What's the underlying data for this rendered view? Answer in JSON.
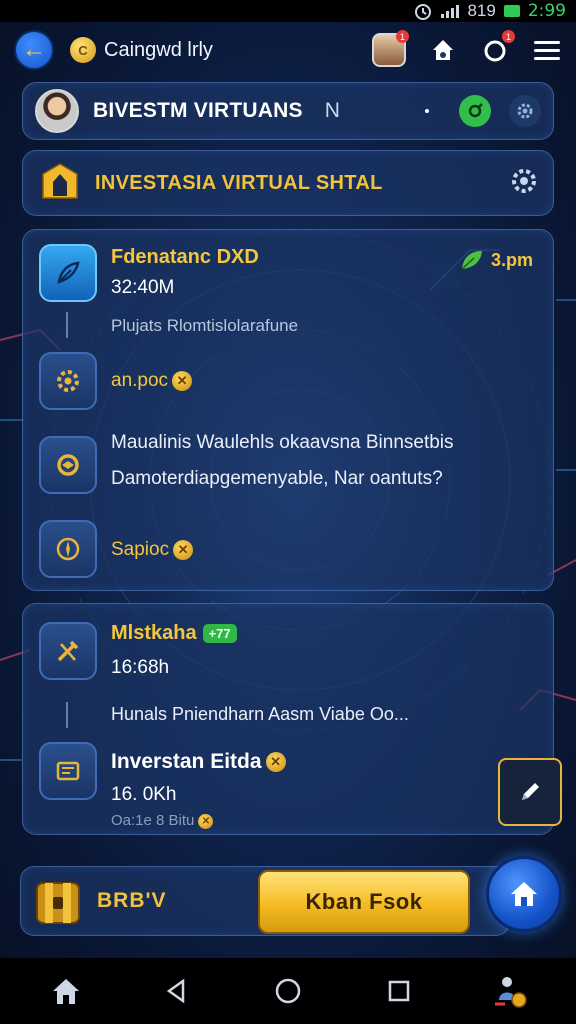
{
  "status_bar": {
    "clock": "2:99",
    "sim_text": "819"
  },
  "app_bar": {
    "title": "Caingwd lrly",
    "notification_count": "1",
    "alert_count": "1"
  },
  "profile": {
    "name": "BIVESTM VIRTUANS",
    "suffix": "N"
  },
  "section": {
    "title": "INVESTASIA VIRTUAL SHTAL"
  },
  "card1": {
    "title": "Fdenatanc DXD",
    "amount": "32:40M",
    "time": "3.pm",
    "subtitle": "Plujats Rlomtislolarafune",
    "reward1": "an.poc",
    "message_line1": "Maualinis Waulehls okaavsna Binnsetbis",
    "message_line2": "Damoterdiapgemenyable, Nar oantuts?",
    "reward2": "Sapioc"
  },
  "card2": {
    "title": "Mlstkaha",
    "badge": "+77",
    "amount": "16:68h",
    "subtitle": "Hunals Pniendharn Aasm Viabe Oo...",
    "item_title": "Inverstan Eitda",
    "item_amount": "16. 0Kh",
    "item_footnote": "Oa:1e 8 Bitu"
  },
  "bottom": {
    "brand": "BRB'V",
    "cta": "Kban Fsok"
  },
  "colors": {
    "accent_gold": "#f5c53b",
    "accent_blue": "#1f6fe0",
    "background": "#0e2250"
  }
}
